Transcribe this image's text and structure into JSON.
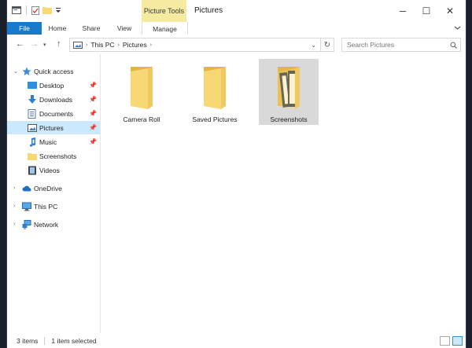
{
  "title": "Pictures",
  "contextual_tab": "Picture Tools",
  "ribbon_tabs": [
    "File",
    "Home",
    "Share",
    "View",
    "Manage"
  ],
  "breadcrumb": [
    "This PC",
    "Pictures"
  ],
  "search": {
    "placeholder": "Search Pictures"
  },
  "nav": [
    {
      "label": "Quick access",
      "icon": "star-icon",
      "pinned": false
    },
    {
      "label": "Desktop",
      "icon": "desktop-icon",
      "pinned": true
    },
    {
      "label": "Downloads",
      "icon": "download-icon",
      "pinned": true
    },
    {
      "label": "Documents",
      "icon": "documents-icon",
      "pinned": true
    },
    {
      "label": "Pictures",
      "icon": "pictures-icon",
      "pinned": true,
      "selected": true
    },
    {
      "label": "Music",
      "icon": "music-icon",
      "pinned": true
    },
    {
      "label": "Screenshots",
      "icon": "folder-icon",
      "pinned": false
    },
    {
      "label": "Videos",
      "icon": "videos-icon",
      "pinned": false
    },
    {
      "label": "OneDrive",
      "icon": "cloud-icon"
    },
    {
      "label": "This PC",
      "icon": "computer-icon"
    },
    {
      "label": "Network",
      "icon": "network-icon"
    }
  ],
  "items": [
    {
      "name": "Camera Roll",
      "type": "folder",
      "selected": false
    },
    {
      "name": "Saved Pictures",
      "type": "folder",
      "selected": false
    },
    {
      "name": "Screenshots",
      "type": "folder-with-content",
      "selected": true
    }
  ],
  "status": {
    "item_count": "3 items",
    "selection": "1 item selected"
  },
  "colors": {
    "file_tab": "#1979ca",
    "contextual_tab": "#f6eaa1",
    "selection": "#cce8ff",
    "folder": "#f8d775"
  }
}
